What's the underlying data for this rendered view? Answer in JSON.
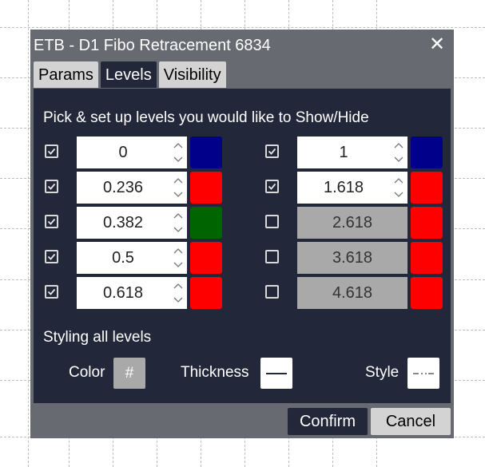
{
  "dialog": {
    "title": "ETB - D1 Fibo Retracement 6834",
    "close_icon": "close-icon",
    "tabs": [
      {
        "label": "Params",
        "active": false
      },
      {
        "label": "Levels",
        "active": true
      },
      {
        "label": "Visibility",
        "active": false
      }
    ]
  },
  "levels_panel": {
    "heading": "Pick & set up levels you would like to Show/Hide",
    "left": [
      {
        "checked": true,
        "value": "0",
        "color": "#00008b"
      },
      {
        "checked": true,
        "value": "0.236",
        "color": "#ff0000"
      },
      {
        "checked": true,
        "value": "0.382",
        "color": "#006400"
      },
      {
        "checked": true,
        "value": "0.5",
        "color": "#ff0000"
      },
      {
        "checked": true,
        "value": "0.618",
        "color": "#ff0000"
      }
    ],
    "right": [
      {
        "checked": true,
        "value": "1",
        "color": "#00008b"
      },
      {
        "checked": true,
        "value": "1.618",
        "color": "#ff0000"
      },
      {
        "checked": false,
        "value": "2.618",
        "color": "#ff0000"
      },
      {
        "checked": false,
        "value": "3.618",
        "color": "#ff0000"
      },
      {
        "checked": false,
        "value": "4.618",
        "color": "#ff0000"
      }
    ],
    "spin_up": "^",
    "spin_down": "v"
  },
  "styling": {
    "title": "Styling all levels",
    "color_label": "Color",
    "color_button": "#",
    "thickness_label": "Thickness",
    "style_label": "Style"
  },
  "footer": {
    "confirm": "Confirm",
    "cancel": "Cancel"
  }
}
